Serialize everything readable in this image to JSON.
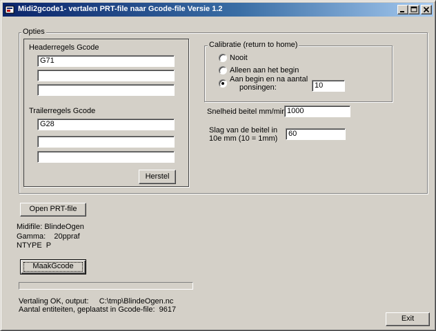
{
  "window": {
    "title": "Midi2gcode1- vertalen PRT-file  naar  Gcode-file  Versie 1.2",
    "minimize": "_",
    "maximize": "□",
    "close": "×"
  },
  "options": {
    "label": "Opties",
    "header": {
      "label": "Headerregels Gcode",
      "lines": [
        "G71",
        "",
        ""
      ]
    },
    "trailer": {
      "label": "Trailerregels Gcode",
      "lines": [
        "G28",
        "",
        ""
      ]
    },
    "reset_button": "Herstel",
    "calibration": {
      "label": "Calibratie (return to home)",
      "options": [
        "Nooit",
        "Alleen aan het begin",
        "Aan begin en na aantal",
        "ponsingen:"
      ],
      "selected_index": 2,
      "count_value": "10"
    },
    "speed": {
      "label": "Snelheid beitel mm/min:",
      "value": "1000"
    },
    "stroke": {
      "label_line1": "Slag van de beitel in",
      "label_line2": "10e mm (10 = 1mm)",
      "value": "60"
    }
  },
  "open_button": "Open PRT-file",
  "file_info": {
    "midifile": "Midifile: BlindeOgen",
    "gamma": "Gamma:    20ppraf",
    "ntype": "NTYPE  P"
  },
  "make_button": "MaakGcode",
  "progress": {
    "fraction": 0
  },
  "status": {
    "line1": "Vertaling OK, output:     C:\\tmp\\BlindeOgen.nc",
    "line2": "Aantal entiteiten, geplaatst in Gcode-file:  9617"
  },
  "exit_button": "Exit"
}
